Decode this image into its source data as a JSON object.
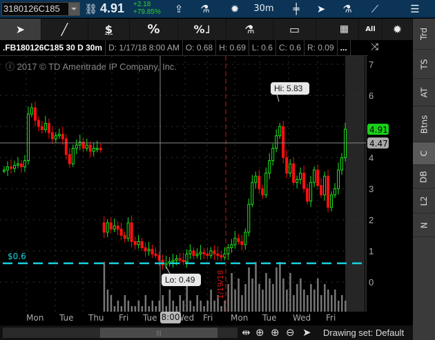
{
  "topbar": {
    "symbol": "3180126C185",
    "last": "4.91",
    "change": "+2.18",
    "change_pct": "+79.85%",
    "timeframe": "30m"
  },
  "tools": {
    "pct": "%",
    "all": "All",
    "dollar": "$"
  },
  "info": {
    "title": ".FB180126C185 30 D 30m",
    "date": "D: 1/17/18 8:00 AM",
    "open": "O: 0.68",
    "high": "H: 0.69",
    "low": "L: 0.6",
    "close": "C: 0.6",
    "range": "R: 0.09",
    "more": "..."
  },
  "sidebar": {
    "tabs": [
      "Trd",
      "TS",
      "AT",
      "Btns",
      "C",
      "DB",
      "L2",
      "N"
    ],
    "selected": "C"
  },
  "chart": {
    "copyright": "2017 © TD Ameritrade IP Company, Inc.",
    "hi_label": "Hi: 5.83",
    "lo_label": "Lo: 0.49",
    "last_price": "4.91",
    "crosshair_price": "4.47",
    "crosshair_value": 4.47,
    "alert_level_label": "$0.6",
    "alert_level": 0.6,
    "split_date_label": "1/19/18",
    "y_ticks": [
      "7",
      "6",
      "4",
      "3",
      "2",
      "1",
      "0"
    ],
    "y_range": [
      0,
      7
    ],
    "colors": {
      "up": "#1fe81f",
      "down": "#ff1010",
      "alert": "#19d4e0",
      "last": "#18d018",
      "split": "#d01818"
    },
    "closes": [
      3.6,
      3.7,
      3.65,
      3.75,
      3.8,
      3.7,
      3.9,
      5.4,
      5.6,
      5.2,
      5.0,
      4.9,
      5.1,
      4.8,
      4.6,
      4.7,
      4.75,
      4.6,
      4.1,
      3.8,
      4.3,
      4.4,
      4.5,
      4.3,
      4.4,
      4.2,
      4.3,
      4.3,
      4.25,
      1.6,
      1.9,
      1.7,
      1.8,
      1.7,
      1.5,
      1.4,
      1.9,
      1.3,
      1.2,
      1.3,
      1.1,
      1.0,
      1.05,
      0.9,
      0.85,
      0.7,
      0.55,
      0.6,
      0.65,
      0.7,
      0.75,
      0.7,
      0.65,
      0.9,
      1.0,
      0.85,
      0.9,
      0.95,
      0.9,
      0.85,
      1.0,
      0.9,
      0.85,
      0.8,
      0.9,
      1.1,
      1.2,
      1.4,
      1.3,
      1.2,
      1.6,
      2.5,
      3.2,
      3.4,
      3.0,
      2.8,
      3.5,
      3.9,
      4.3,
      4.7,
      5.0,
      4.0,
      3.5,
      3.8,
      3.2,
      3.3,
      3.5,
      3.0,
      2.6,
      3.2,
      3.6,
      3.1,
      2.8,
      3.4,
      2.4,
      2.8,
      3.0,
      3.6,
      4.0,
      4.91
    ],
    "volumes": [
      0,
      0,
      0,
      0,
      0,
      0,
      0,
      0,
      0,
      0,
      0,
      0,
      0,
      0,
      0,
      0,
      0,
      0,
      0,
      0,
      0,
      0,
      0,
      0,
      0,
      0,
      0,
      0,
      0,
      9,
      4,
      3,
      1,
      2,
      1,
      3,
      2,
      1,
      1,
      2,
      1,
      3,
      1,
      2,
      1,
      2,
      3,
      1,
      4,
      2,
      1,
      3,
      2,
      6,
      2,
      1,
      3,
      2,
      1,
      2,
      4,
      2,
      3,
      1,
      2,
      5,
      7,
      4,
      6,
      3,
      5,
      8,
      6,
      9,
      5,
      4,
      7,
      6,
      5,
      8,
      9,
      6,
      4,
      7,
      3,
      5,
      6,
      4,
      3,
      5,
      4,
      6,
      3,
      5,
      4,
      3,
      4,
      2,
      3,
      2
    ]
  },
  "dates": [
    "Mon",
    "Tue",
    "Thu",
    "Fri",
    "Tue",
    "Wed",
    "Fri",
    "Mon",
    "Tue",
    "Wed",
    "Fri"
  ],
  "cursor_time": "8:00",
  "bottom": {
    "drawing_set": "Drawing set: Default"
  }
}
